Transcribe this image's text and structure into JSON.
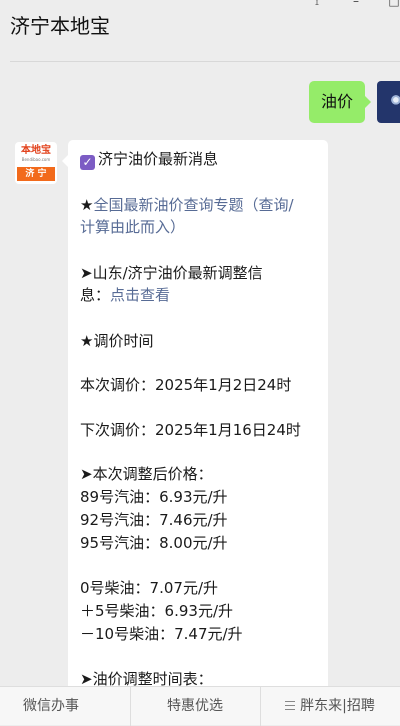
{
  "window": {
    "title": "济宁本地宝",
    "controls": [
      "pin-icon",
      "minimize-icon",
      "maximize-icon"
    ]
  },
  "chat": {
    "outgoing": {
      "text": "油价"
    },
    "bot_avatar": {
      "brand": "本地宝",
      "domain": "Bendibao.com",
      "city": "济 宁"
    },
    "message": {
      "heading": "济宁油价最新消息",
      "link1_prefix": "★",
      "link1_line1": "全国最新油价查询专题（查询/",
      "link1_line2": "计算由此而入）",
      "sd_line1": "➤山东/济宁油价最新调整信",
      "sd_line2_prefix": "息：",
      "sd_link": "点击查看",
      "time_title": "★调价时间",
      "this_adjust": "本次调价：2025年1月2日24时",
      "next_adjust": "下次调价：2025年1月16日24时",
      "prices_title": "➤本次调整后价格：",
      "gasoline": [
        "89号汽油：6.93元/升",
        "92号汽油：7.46元/升",
        "95号汽油：8.00元/升"
      ],
      "diesel": [
        "0号柴油：7.07元/升",
        "＋5号柴油：6.93元/升",
        "－10号柴油：7.47元/升"
      ],
      "schedule_title": "➤油价调整时间表："
    }
  },
  "bottom_menu": {
    "tab1": "微信办事",
    "tab2": "特惠优选",
    "tab3": "胖东来|招聘"
  }
}
